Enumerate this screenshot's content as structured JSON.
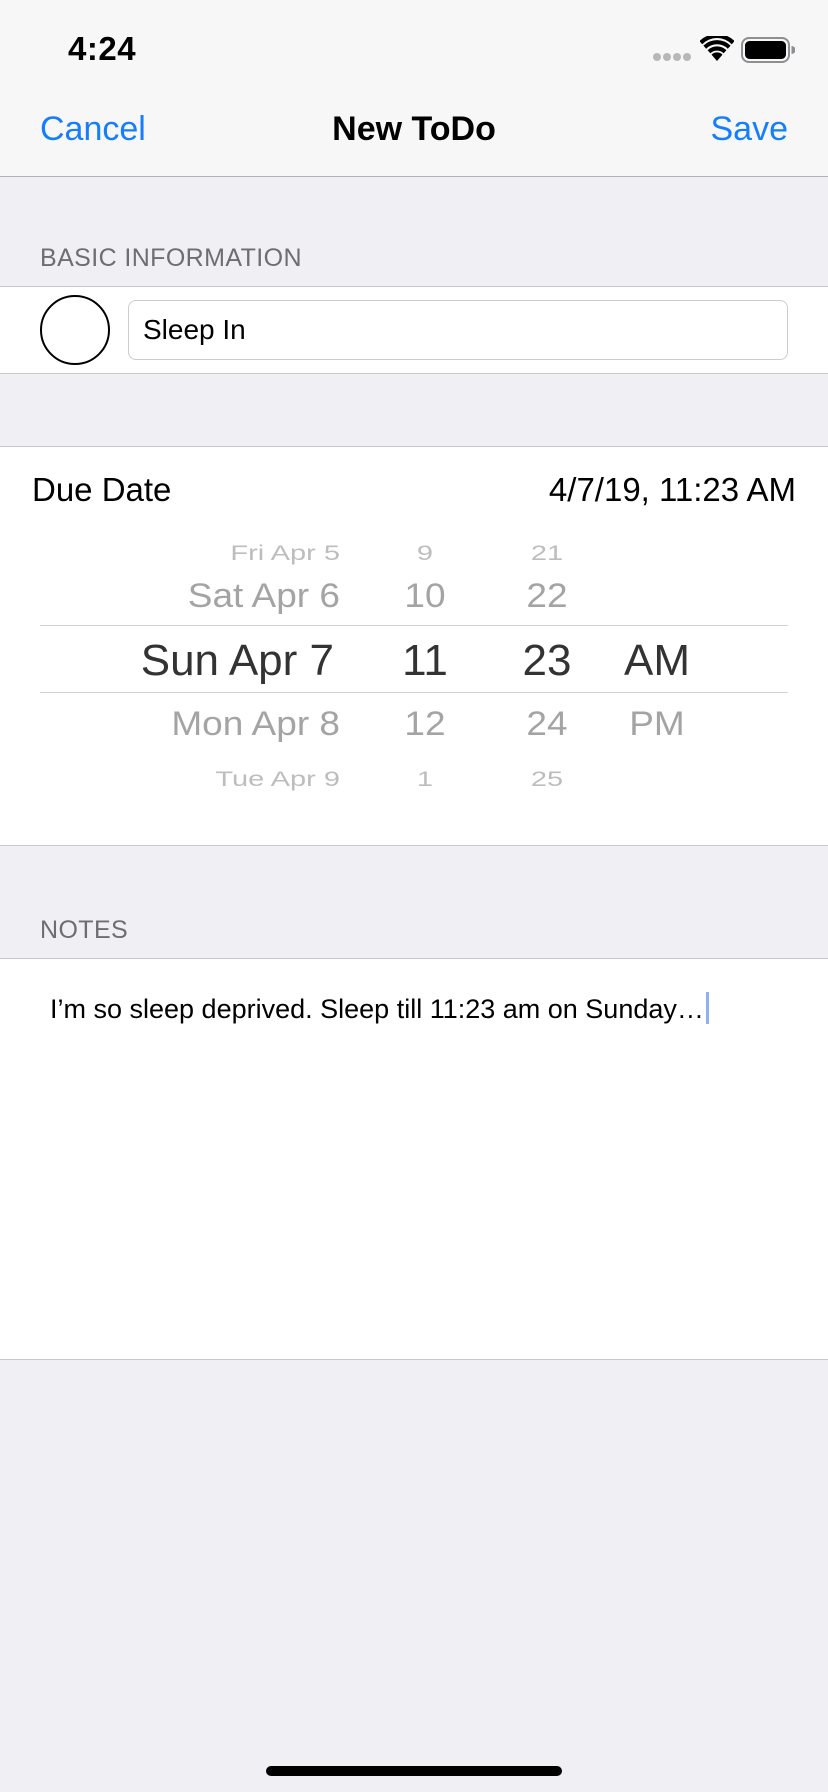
{
  "status_bar": {
    "time": "4:24"
  },
  "nav": {
    "cancel_label": "Cancel",
    "title": "New ToDo",
    "save_label": "Save"
  },
  "basic_info": {
    "header": "BASIC INFORMATION",
    "title_value": "Sleep In"
  },
  "due_date": {
    "label": "Due Date",
    "value": "4/7/19, 11:23 AM",
    "picker": {
      "dates": [
        "Fri Apr 5",
        "Sat Apr 6",
        "Sun Apr 7",
        "Mon Apr 8",
        "Tue Apr 9"
      ],
      "hours": [
        "9",
        "10",
        "11",
        "12",
        "1"
      ],
      "minutes": [
        "21",
        "22",
        "23",
        "24",
        "25"
      ],
      "ampm": [
        "AM",
        "PM"
      ],
      "selected": {
        "date": "Sun Apr 7",
        "hour": "11",
        "minute": "23",
        "ampm": "AM"
      }
    }
  },
  "notes": {
    "header": "NOTES",
    "text": "I’m so sleep deprived. Sleep till 11:23 am on Sunday…"
  },
  "colors": {
    "accent": "#147EFB",
    "background": "#EFEFF4",
    "separator": "#C8C7CC"
  },
  "icons": [
    "signal-icon",
    "wifi-icon",
    "battery-icon"
  ]
}
